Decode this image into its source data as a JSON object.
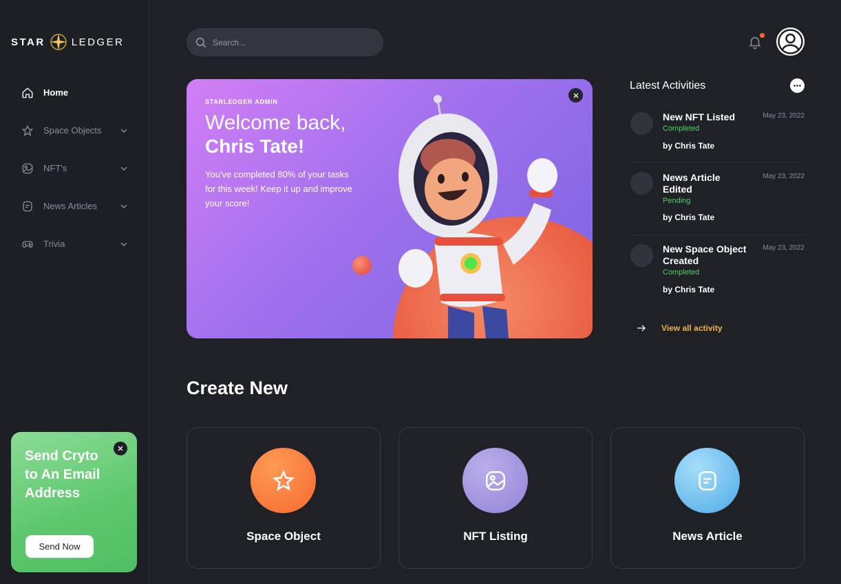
{
  "brand": {
    "part1": "STAR",
    "part2": "LEDGER"
  },
  "nav": [
    {
      "label": "Home",
      "active": true,
      "icon": "home-icon"
    },
    {
      "label": "Space Objects",
      "icon": "star-icon"
    },
    {
      "label": "NFT's",
      "icon": "image-icon"
    },
    {
      "label": "News Articles",
      "icon": "note-icon"
    },
    {
      "label": "Trivia",
      "icon": "gamepad-icon"
    }
  ],
  "promo": {
    "title": "Send Cryto to An Email Address",
    "button": "Send Now"
  },
  "search": {
    "placeholder": "Search..."
  },
  "hero": {
    "tag": "STARLEDGER ADMIN",
    "line1": "Welcome back,",
    "line2": "Chris Tate!",
    "text": "You've completed 80% of your tasks for this week! Keep it up and improve your score!"
  },
  "activities": {
    "title": "Latest Activities",
    "items": [
      {
        "name": "New NFT Listed",
        "status": "Completed",
        "by": "by Chris Tate",
        "date": "May 23, 2022"
      },
      {
        "name": "News Article Edited",
        "status": "Pending",
        "by": "by Chris Tate",
        "date": "May 23, 2022"
      },
      {
        "name": "New Space Object Created",
        "status": "Completed",
        "by": "by Chris Tate",
        "date": "May 23, 2022"
      }
    ],
    "view_all": "View all activity"
  },
  "create": {
    "title": "Create New",
    "cards": [
      {
        "label": "Space Object",
        "icon": "star-icon",
        "color": "#ff7a3d"
      },
      {
        "label": "NFT Listing",
        "icon": "image-icon",
        "color": "#a08fdc"
      },
      {
        "label": "News Article",
        "icon": "note-icon",
        "color": "#5bb6ee"
      }
    ]
  }
}
